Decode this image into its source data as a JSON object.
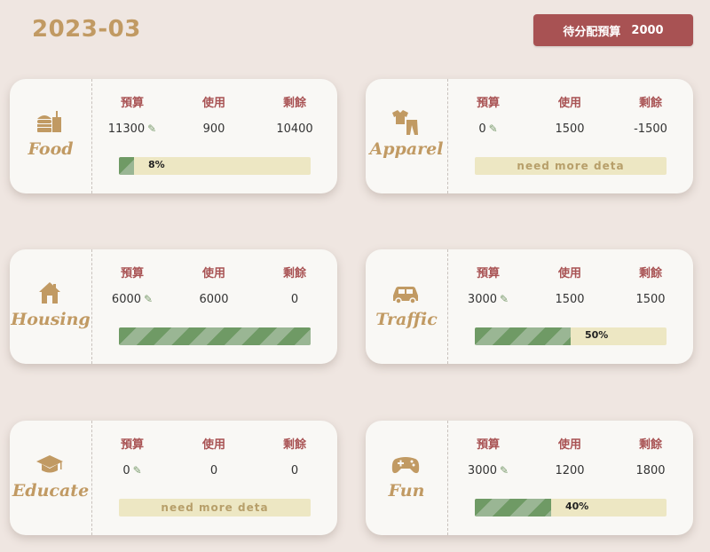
{
  "header": {
    "month": "2023-03",
    "unallocated_label": "待分配預算",
    "unallocated_value": "2000"
  },
  "columns": {
    "budget": "預算",
    "used": "使用",
    "remaining": "剩餘"
  },
  "cards": [
    {
      "category": "Food",
      "icon": "food-icon",
      "budget": "11300",
      "used": "900",
      "remaining": "10400",
      "progress": 8,
      "bar_text": "8%",
      "message": ""
    },
    {
      "category": "Apparel",
      "icon": "apparel-icon",
      "budget": "0",
      "used": "1500",
      "remaining": "-1500",
      "progress": 0,
      "bar_text": "",
      "message": "need more deta"
    },
    {
      "category": "Housing",
      "icon": "house-icon",
      "budget": "6000",
      "used": "6000",
      "remaining": "0",
      "progress": 100,
      "bar_text": "",
      "message": ""
    },
    {
      "category": "Traffic",
      "icon": "car-icon",
      "budget": "3000",
      "used": "1500",
      "remaining": "1500",
      "progress": 50,
      "bar_text": "50%",
      "message": ""
    },
    {
      "category": "Educate",
      "icon": "graduation-cap-icon",
      "budget": "0",
      "used": "0",
      "remaining": "0",
      "progress": 0,
      "bar_text": "",
      "message": "need more deta"
    },
    {
      "category": "Fun",
      "icon": "gamepad-icon",
      "budget": "3000",
      "used": "1200",
      "remaining": "1800",
      "progress": 40,
      "bar_text": "40%",
      "message": ""
    }
  ],
  "colors": {
    "accent": "#a85253",
    "gold": "#c19a63",
    "green": "#6f9a65",
    "bar_bg": "#ede7c3",
    "background": "#efe6e1"
  }
}
